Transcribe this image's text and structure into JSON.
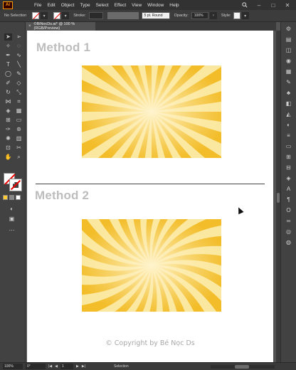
{
  "app": {
    "logo": "Ai",
    "accent": "#ff9a00"
  },
  "menu": [
    "File",
    "Edit",
    "Object",
    "Type",
    "Select",
    "Effect",
    "View",
    "Window",
    "Help"
  ],
  "window_controls": {
    "search_icon": "search-icon",
    "minimize": "–",
    "maximize": "□",
    "close": "✕"
  },
  "control_bar": {
    "selection_label": "No Selection",
    "stroke_label": "Stroke:",
    "brush_value": "5 pt. Round",
    "opacity_label": "Opacity:",
    "opacity_value": "100%",
    "style_label": "Style:"
  },
  "document_tab": {
    "close": "×",
    "title": "©BiNocDs.ai* @ 100 % (RGB/Preview)"
  },
  "artboard": {
    "method1_title": "Method 1",
    "method2_title": "Method 2",
    "copyright": "© Copyright by Bé Nọc Ds",
    "sunburst_colors": {
      "light": "#fbe8a0",
      "dark": "#f3bd2a",
      "center": "#fff4cf"
    }
  },
  "status_bar": {
    "zoom": "100%",
    "rotation": "0°",
    "artboard_nav_first": "|◀",
    "artboard_nav_prev": "◀",
    "artboard_number": "1",
    "artboard_nav_next": "▶",
    "artboard_nav_last": "▶|",
    "tool_name": "Selection"
  }
}
